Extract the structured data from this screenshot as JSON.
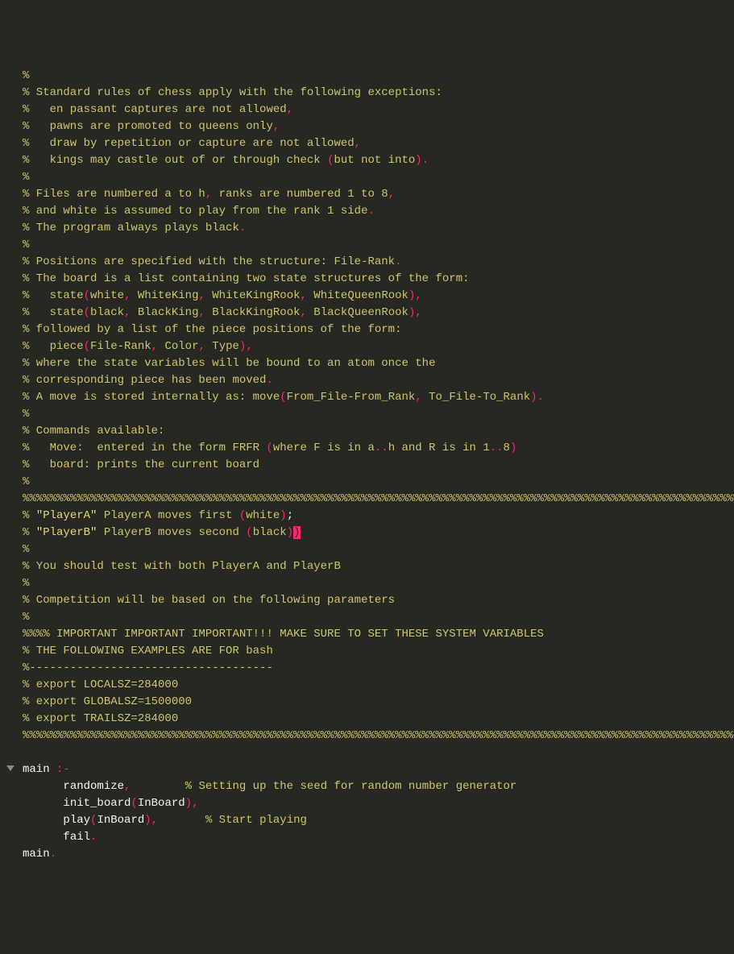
{
  "code": {
    "tokens": [
      [
        {
          "c": "comment",
          "t": "%"
        }
      ],
      [
        {
          "c": "comment",
          "t": "% Standard rules of chess apply with the following exceptions:"
        }
      ],
      [
        {
          "c": "comment",
          "t": "%   en passant captures are not allowed"
        },
        {
          "c": "punct",
          "t": ","
        }
      ],
      [
        {
          "c": "comment",
          "t": "%   pawns are promoted to queens only"
        },
        {
          "c": "punct",
          "t": ","
        }
      ],
      [
        {
          "c": "comment",
          "t": "%   draw by repetition or capture are not allowed"
        },
        {
          "c": "punct",
          "t": ","
        }
      ],
      [
        {
          "c": "comment",
          "t": "%   kings may castle out of or through check "
        },
        {
          "c": "punct",
          "t": "("
        },
        {
          "c": "comment",
          "t": "but not into"
        },
        {
          "c": "punct",
          "t": ")"
        },
        {
          "c": "punct",
          "t": "."
        }
      ],
      [
        {
          "c": "comment",
          "t": "%"
        }
      ],
      [
        {
          "c": "comment",
          "t": "% Files are numbered a to h"
        },
        {
          "c": "punct",
          "t": ","
        },
        {
          "c": "comment",
          "t": " ranks are numbered 1 to 8"
        },
        {
          "c": "punct",
          "t": ","
        }
      ],
      [
        {
          "c": "comment",
          "t": "% and white is assumed to play from the rank 1 side"
        },
        {
          "c": "punct",
          "t": "."
        }
      ],
      [
        {
          "c": "comment",
          "t": "% The program always plays black"
        },
        {
          "c": "punct",
          "t": "."
        }
      ],
      [
        {
          "c": "comment",
          "t": "%"
        }
      ],
      [
        {
          "c": "comment",
          "t": "% Positions are specified with the structure: File-Rank"
        },
        {
          "c": "punct",
          "t": "."
        }
      ],
      [
        {
          "c": "comment",
          "t": "% The board is a list containing two state structures of the form:"
        }
      ],
      [
        {
          "c": "comment",
          "t": "%   state"
        },
        {
          "c": "punct",
          "t": "("
        },
        {
          "c": "comment",
          "t": "white"
        },
        {
          "c": "punct",
          "t": ","
        },
        {
          "c": "comment",
          "t": " WhiteKing"
        },
        {
          "c": "punct",
          "t": ","
        },
        {
          "c": "comment",
          "t": " WhiteKingRook"
        },
        {
          "c": "punct",
          "t": ","
        },
        {
          "c": "comment",
          "t": " WhiteQueenRook"
        },
        {
          "c": "punct",
          "t": ")"
        },
        {
          "c": "punct",
          "t": ","
        }
      ],
      [
        {
          "c": "comment",
          "t": "%   state"
        },
        {
          "c": "punct",
          "t": "("
        },
        {
          "c": "comment",
          "t": "black"
        },
        {
          "c": "punct",
          "t": ","
        },
        {
          "c": "comment",
          "t": " BlackKing"
        },
        {
          "c": "punct",
          "t": ","
        },
        {
          "c": "comment",
          "t": " BlackKingRook"
        },
        {
          "c": "punct",
          "t": ","
        },
        {
          "c": "comment",
          "t": " BlackQueenRook"
        },
        {
          "c": "punct",
          "t": ")"
        },
        {
          "c": "punct",
          "t": ","
        }
      ],
      [
        {
          "c": "comment",
          "t": "% followed by a list of the piece positions of the form:"
        }
      ],
      [
        {
          "c": "comment",
          "t": "%   piece"
        },
        {
          "c": "punct",
          "t": "("
        },
        {
          "c": "comment",
          "t": "File-Rank"
        },
        {
          "c": "punct",
          "t": ","
        },
        {
          "c": "comment",
          "t": " Color"
        },
        {
          "c": "punct",
          "t": ","
        },
        {
          "c": "comment",
          "t": " Type"
        },
        {
          "c": "punct",
          "t": ")"
        },
        {
          "c": "punct",
          "t": ","
        }
      ],
      [
        {
          "c": "comment",
          "t": "% where the state variables will be bound to an atom once the"
        }
      ],
      [
        {
          "c": "comment",
          "t": "% corresponding piece has been moved"
        },
        {
          "c": "punct",
          "t": "."
        }
      ],
      [
        {
          "c": "comment",
          "t": "% A move is stored internally as: move"
        },
        {
          "c": "punct",
          "t": "("
        },
        {
          "c": "comment",
          "t": "From_File-From_Rank"
        },
        {
          "c": "punct",
          "t": ","
        },
        {
          "c": "comment",
          "t": " To_File-To_Rank"
        },
        {
          "c": "punct",
          "t": ")"
        },
        {
          "c": "punct",
          "t": "."
        }
      ],
      [
        {
          "c": "comment",
          "t": "%"
        }
      ],
      [
        {
          "c": "comment",
          "t": "% Commands available:"
        }
      ],
      [
        {
          "c": "comment",
          "t": "%   Move:  entered in the form FRFR "
        },
        {
          "c": "punct",
          "t": "("
        },
        {
          "c": "comment",
          "t": "where F is in a"
        },
        {
          "c": "punct",
          "t": ".."
        },
        {
          "c": "comment",
          "t": "h and R is in 1"
        },
        {
          "c": "punct",
          "t": ".."
        },
        {
          "c": "comment",
          "t": "8"
        },
        {
          "c": "punct",
          "t": ")"
        }
      ],
      [
        {
          "c": "comment",
          "t": "%   board: prints the current board"
        }
      ],
      [
        {
          "c": "comment",
          "t": "%"
        }
      ],
      [
        {
          "c": "comment",
          "t": "%%%%%%%%%%%%%%%%%%%%%%%%%%%%%%%%%%%%%%%%%%%%%%%%%%%%%%%%%%%%%%%%%%%%%%%%%%%%%%%%%%%%%%%%%%%%%%%%%%%%%%%%%%%%"
        }
      ],
      [
        {
          "c": "comment",
          "t": "% "
        },
        {
          "c": "string",
          "t": "\"PlayerA\""
        },
        {
          "c": "comment",
          "t": " PlayerA moves first "
        },
        {
          "c": "punct",
          "t": "("
        },
        {
          "c": "comment",
          "t": "white"
        },
        {
          "c": "punct",
          "t": ")"
        },
        {
          "c": "text",
          "t": ";"
        }
      ],
      [
        {
          "c": "comment",
          "t": "% "
        },
        {
          "c": "string",
          "t": "\"PlayerB\""
        },
        {
          "c": "comment",
          "t": " PlayerB moves second "
        },
        {
          "c": "punct",
          "t": "("
        },
        {
          "c": "comment",
          "t": "black"
        },
        {
          "c": "punct",
          "t": ")"
        },
        {
          "c": "cursor-rev",
          "t": ")"
        }
      ],
      [
        {
          "c": "comment",
          "t": "%"
        }
      ],
      [
        {
          "c": "comment",
          "t": "% You should test with both PlayerA and PlayerB"
        }
      ],
      [
        {
          "c": "comment",
          "t": "%"
        }
      ],
      [
        {
          "c": "comment",
          "t": "% Competition will be based on the following parameters"
        }
      ],
      [
        {
          "c": "comment",
          "t": "%"
        }
      ],
      [
        {
          "c": "comment",
          "t": "%%%% IMPORTANT IMPORTANT IMPORTANT!!! MAKE SURE TO SET THESE SYSTEM VARIABLES"
        }
      ],
      [
        {
          "c": "comment",
          "t": "% THE FOLLOWING EXAMPLES ARE FOR bash"
        }
      ],
      [
        {
          "c": "comment",
          "t": "%------------------------------------"
        }
      ],
      [
        {
          "c": "comment",
          "t": "% export LOCALSZ=284000"
        }
      ],
      [
        {
          "c": "comment",
          "t": "% export GLOBALSZ=1500000"
        }
      ],
      [
        {
          "c": "comment",
          "t": "% export TRAILSZ=284000"
        }
      ],
      [
        {
          "c": "comment",
          "t": "%%%%%%%%%%%%%%%%%%%%%%%%%%%%%%%%%%%%%%%%%%%%%%%%%%%%%%%%%%%%%%%%%%%%%%%%%%%%%%%%%%%%%%%%%%%%%%%%%%%%%%%%%"
        }
      ],
      [],
      [
        {
          "fold": true
        },
        {
          "c": "text",
          "t": "main "
        },
        {
          "c": "punct",
          "t": ":-"
        }
      ],
      [
        {
          "indent": "      "
        },
        {
          "c": "text",
          "t": "randomize"
        },
        {
          "c": "punct",
          "t": ","
        },
        {
          "c": "comment",
          "t": "        % Setting up the seed for random number generator"
        }
      ],
      [
        {
          "indent": "      "
        },
        {
          "c": "text",
          "t": "init_board"
        },
        {
          "c": "punct",
          "t": "("
        },
        {
          "c": "text",
          "t": "InBoard"
        },
        {
          "c": "punct",
          "t": ")"
        },
        {
          "c": "punct",
          "t": ","
        }
      ],
      [
        {
          "indent": "      "
        },
        {
          "c": "text",
          "t": "play"
        },
        {
          "c": "punct",
          "t": "("
        },
        {
          "c": "text",
          "t": "InBoard"
        },
        {
          "c": "punct",
          "t": ")"
        },
        {
          "c": "punct",
          "t": ","
        },
        {
          "c": "comment",
          "t": "       % Start playing"
        }
      ],
      [
        {
          "indent": "      "
        },
        {
          "c": "text",
          "t": "fail"
        },
        {
          "c": "punct",
          "t": "."
        }
      ],
      [
        {
          "c": "text",
          "t": "main"
        },
        {
          "c": "punct",
          "t": "."
        }
      ]
    ]
  }
}
